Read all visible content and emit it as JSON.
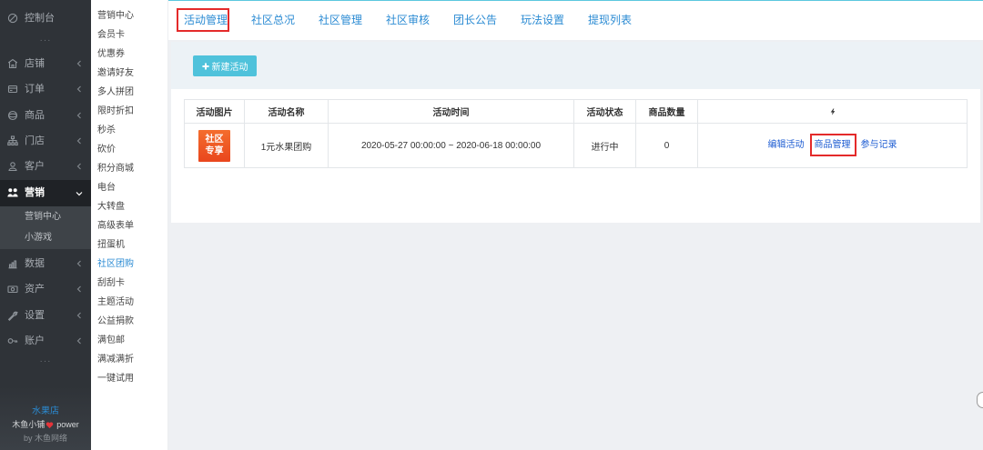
{
  "colors": {
    "sidebar_bg": "#2f3338",
    "accent": "#2b8bd3",
    "link": "#1d5cd2",
    "button": "#4fc2db",
    "highlight": "#e42a2a",
    "badge": "#e9461d"
  },
  "sidebar": {
    "items": [
      {
        "label": "控制台",
        "icon": "dashboard-icon"
      },
      {
        "label": "店铺",
        "icon": "store-icon"
      },
      {
        "label": "订单",
        "icon": "order-icon"
      },
      {
        "label": "商品",
        "icon": "goods-icon"
      },
      {
        "label": "门店",
        "icon": "branch-icon"
      },
      {
        "label": "客户",
        "icon": "customer-icon"
      },
      {
        "label": "营销",
        "icon": "marketing-icon",
        "expanded": true
      },
      {
        "label": "数据",
        "icon": "data-icon"
      },
      {
        "label": "资产",
        "icon": "assets-icon"
      },
      {
        "label": "设置",
        "icon": "settings-icon"
      },
      {
        "label": "账户",
        "icon": "account-icon"
      }
    ],
    "separator": "···",
    "submenu": [
      {
        "label": "营销中心"
      },
      {
        "label": "小游戏"
      }
    ],
    "footer": {
      "shop_name": "水果店",
      "brand": "木鱼小铺",
      "brand_icon": "heart-icon",
      "brand_suffix": "power",
      "credit": "by 木鱼网络"
    }
  },
  "subnav": {
    "items": [
      "营销中心",
      "会员卡",
      "优惠券",
      "邀请好友",
      "多人拼团",
      "限时折扣",
      "秒杀",
      "砍价",
      "积分商城",
      "电台",
      "大转盘",
      "高级表单",
      "扭蛋机",
      "社区团购",
      "刮刮卡",
      "主题活动",
      "公益捐款",
      "满包邮",
      "满减满折",
      "一键试用"
    ],
    "active": "社区团购"
  },
  "tabs": {
    "items": [
      "活动管理",
      "社区总况",
      "社区管理",
      "社区审核",
      "团长公告",
      "玩法设置",
      "提现列表"
    ],
    "active": "活动管理"
  },
  "toolbar": {
    "new_button_label": "新建活动",
    "new_button_icon": "plus-icon"
  },
  "table": {
    "headers": [
      "活动图片",
      "活动名称",
      "活动时间",
      "活动状态",
      "商品数量"
    ],
    "action_header_icon": "lightning-icon",
    "rows": [
      {
        "image_text": [
          "社区",
          "专享"
        ],
        "name": "1元水果团购",
        "time": "2020-05-27 00:00:00 ~ 2020-06-18 00:00:00",
        "status": "进行中",
        "goods_count": "0",
        "actions": [
          "编辑活动",
          "商品管理",
          "参与记录"
        ]
      }
    ]
  }
}
